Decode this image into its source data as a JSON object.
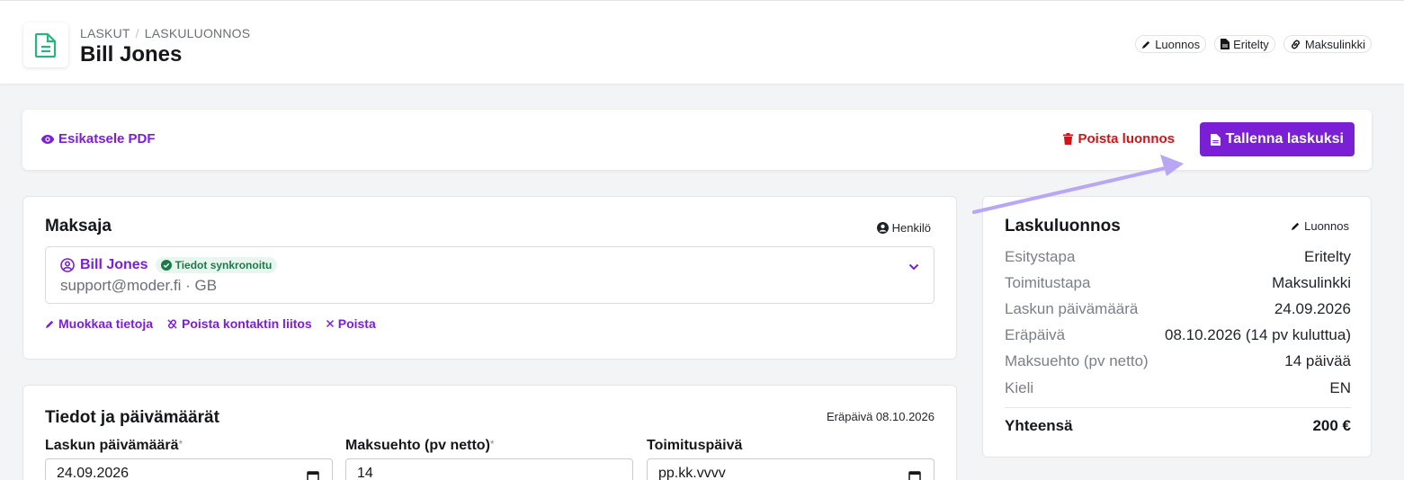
{
  "header": {
    "breadcrumb": [
      "LASKUT",
      "LASKULUONNOS"
    ],
    "title": "Bill Jones",
    "badges": [
      "Luonnos",
      "Eritelty",
      "Maksulinkki"
    ]
  },
  "actions": {
    "preview": "Esikatsele PDF",
    "delete": "Poista luonnos",
    "save": "Tallenna laskuksi"
  },
  "payer": {
    "heading": "Maksaja",
    "type": "Henkilö",
    "name": "Bill Jones",
    "sync_badge": "Tiedot synkronoitu",
    "details": "support@moder.fi · GB",
    "links": [
      "Muokkaa tietoja",
      "Poista kontaktin liitos",
      "Poista"
    ]
  },
  "dates": {
    "heading": "Tiedot ja päivämäärät",
    "due_note": "Eräpäivä 08.10.2026",
    "fields": [
      {
        "label": "Laskun päivämäärä",
        "required": "*",
        "value": "24.09.2026"
      },
      {
        "label": "Maksuehto (pv netto)",
        "required": "*",
        "value": "14"
      },
      {
        "label": "Toimituspäivä",
        "required": "",
        "value": "pp.kk.vvvv"
      }
    ]
  },
  "summary": {
    "heading": "Laskuluonnos",
    "status": "Luonnos",
    "rows": [
      {
        "k": "Esitystapa",
        "v": "Eritelty"
      },
      {
        "k": "Toimitustapa",
        "v": "Maksulinkki"
      },
      {
        "k": "Laskun päivämäärä",
        "v": "24.09.2026"
      },
      {
        "k": "Eräpäivä",
        "v": "08.10.2026 (14 pv kuluttua)"
      },
      {
        "k": "Maksuehto (pv netto)",
        "v": "14 päivää"
      },
      {
        "k": "Kieli",
        "v": "EN"
      }
    ],
    "total_label": "Yhteensä",
    "total_value": "200 €"
  },
  "colors": {
    "accent": "#7a1fd6",
    "danger": "#d01418",
    "success": "#1b7a49",
    "arrow": "#b9a6f5"
  }
}
